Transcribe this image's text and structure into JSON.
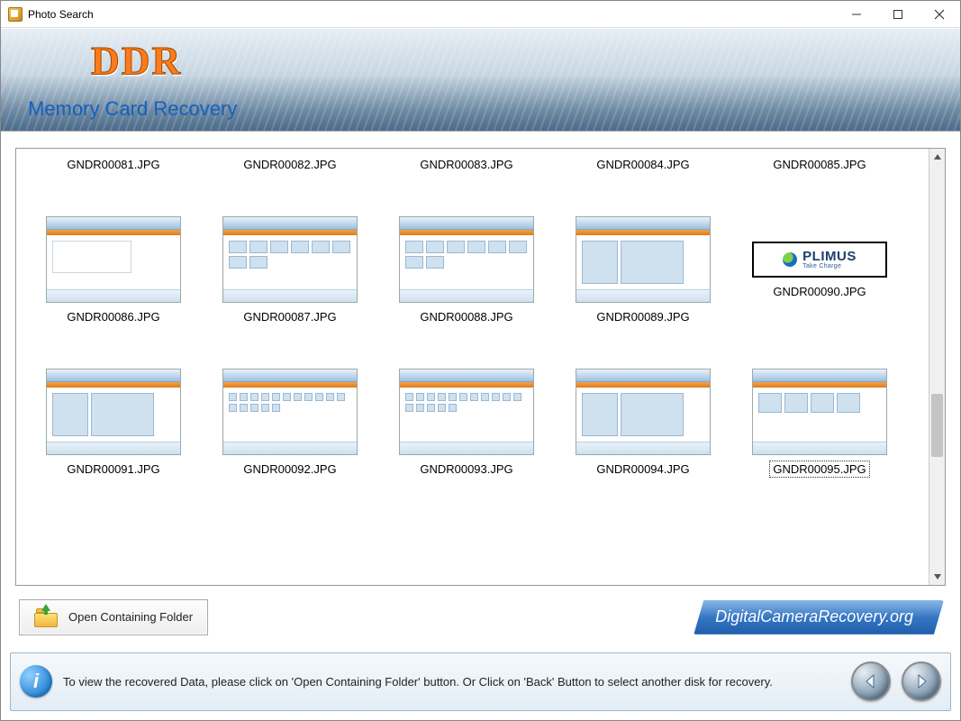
{
  "window": {
    "title": "Photo Search"
  },
  "banner": {
    "logo": "DDR",
    "subtitle": "Memory Card Recovery"
  },
  "files": [
    "GNDR00081.JPG",
    "GNDR00082.JPG",
    "GNDR00083.JPG",
    "GNDR00084.JPG",
    "GNDR00085.JPG",
    "GNDR00086.JPG",
    "GNDR00087.JPG",
    "GNDR00088.JPG",
    "GNDR00089.JPG",
    "GNDR00090.JPG",
    "GNDR00091.JPG",
    "GNDR00092.JPG",
    "GNDR00093.JPG",
    "GNDR00094.JPG",
    "GNDR00095.JPG"
  ],
  "plimus": {
    "name": "PLIMUS",
    "tagline": "Take Charge"
  },
  "selected_index": 14,
  "actions": {
    "open_folder_label": "Open Containing Folder"
  },
  "domain_badge": "DigitalCameraRecovery.org",
  "hint": "To view the recovered Data, please click on 'Open Containing Folder' button. Or Click on 'Back' Button to select another disk for recovery."
}
